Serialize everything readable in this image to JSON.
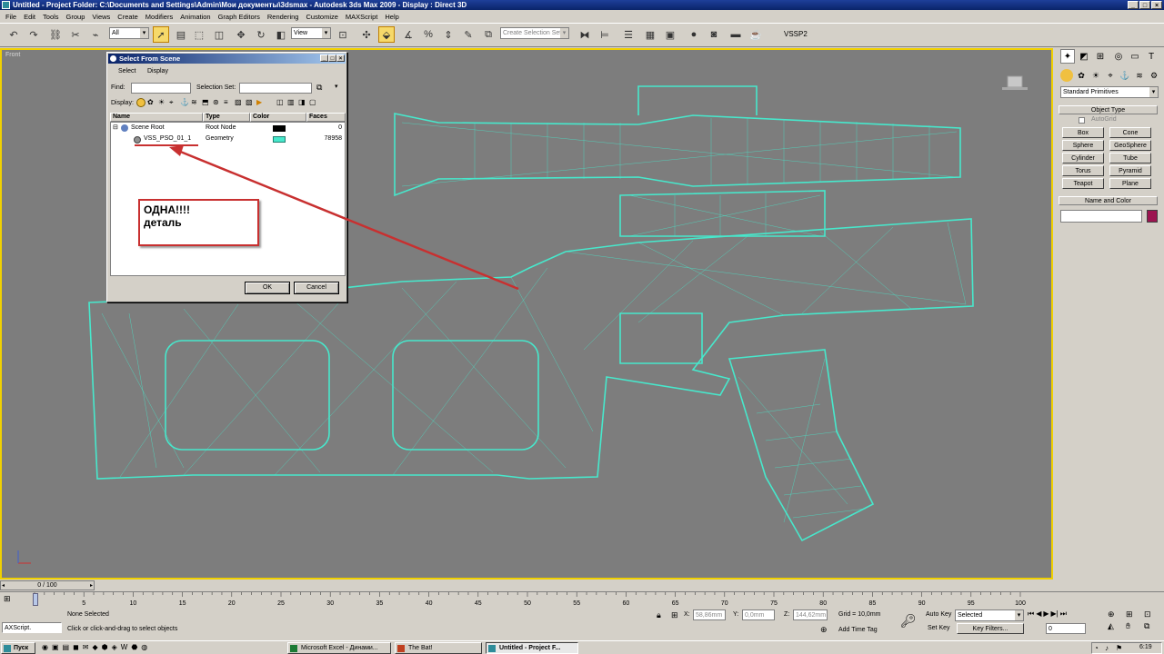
{
  "window": {
    "title": "Untitled   - Project Folder: C:\\Documents and Settings\\Admin\\Мои документы\\3dsmax   - Autodesk 3ds Max  2009    - Display : Direct 3D"
  },
  "menubar": [
    "File",
    "Edit",
    "Tools",
    "Group",
    "Views",
    "Create",
    "Modifiers",
    "Animation",
    "Graph Editors",
    "Rendering",
    "Customize",
    "MAXScript",
    "Help"
  ],
  "toolbar": {
    "filter": "All",
    "refcoord": "View",
    "selset": "Create Selection Set",
    "tag": "VSSP2"
  },
  "viewport": {
    "label": "Front",
    "wire_color": "#47e8cc"
  },
  "dialog": {
    "title": "Select From Scene",
    "menu": [
      "Select",
      "Display"
    ],
    "find_label": "Find:",
    "selset_label": "Selection Set:",
    "display_label": "Display:",
    "columns": [
      "Name",
      "Type",
      "Color",
      "Faces"
    ],
    "rows": [
      {
        "name": "Scene Root",
        "type": "Root Node",
        "color": "#000000",
        "faces": "0"
      },
      {
        "name": "VSS_PSO_01_1",
        "type": "Geometry",
        "color": "#47e8cc",
        "faces": "78958"
      }
    ],
    "ok": "OK",
    "cancel": "Cancel"
  },
  "callout": {
    "line1": "ОДНА!!!!",
    "line2": "деталь"
  },
  "cmdpanel": {
    "dropdown": "Standard Primitives",
    "object_type": "Object Type",
    "autogrid": "AutoGrid",
    "buttons": [
      "Box",
      "Cone",
      "Sphere",
      "GeoSphere",
      "Cylinder",
      "Tube",
      "Torus",
      "Pyramid",
      "Teapot",
      "Plane"
    ],
    "name_color": "Name and Color",
    "swatch": "#9c1450"
  },
  "timeline": {
    "frame": "0 / 100",
    "ticks": [
      "0",
      "5",
      "10",
      "15",
      "20",
      "25",
      "30",
      "35",
      "40",
      "45",
      "50",
      "55",
      "60",
      "65",
      "70",
      "75",
      "80",
      "85",
      "90",
      "95",
      "100"
    ]
  },
  "status": {
    "maxscript": "AXScript.",
    "selected": "None Selected",
    "prompt": "Click or click-and-drag to select objects",
    "x": "58,86mm",
    "y": "0,0mm",
    "z": "144,62mm",
    "grid": "Grid = 10,0mm",
    "addtimetag": "Add Time Tag",
    "autokey": "Auto Key",
    "autokey_mode": "Selected",
    "setkey": "Set Key",
    "keyfilters": "Key Filters...",
    "frame": "0"
  },
  "taskbar": {
    "start": "Пуск",
    "tasks": [
      "Microsoft Excel - Динами...",
      "The Bat!",
      "Untitled     - Project F..."
    ],
    "clock": "6:19"
  }
}
